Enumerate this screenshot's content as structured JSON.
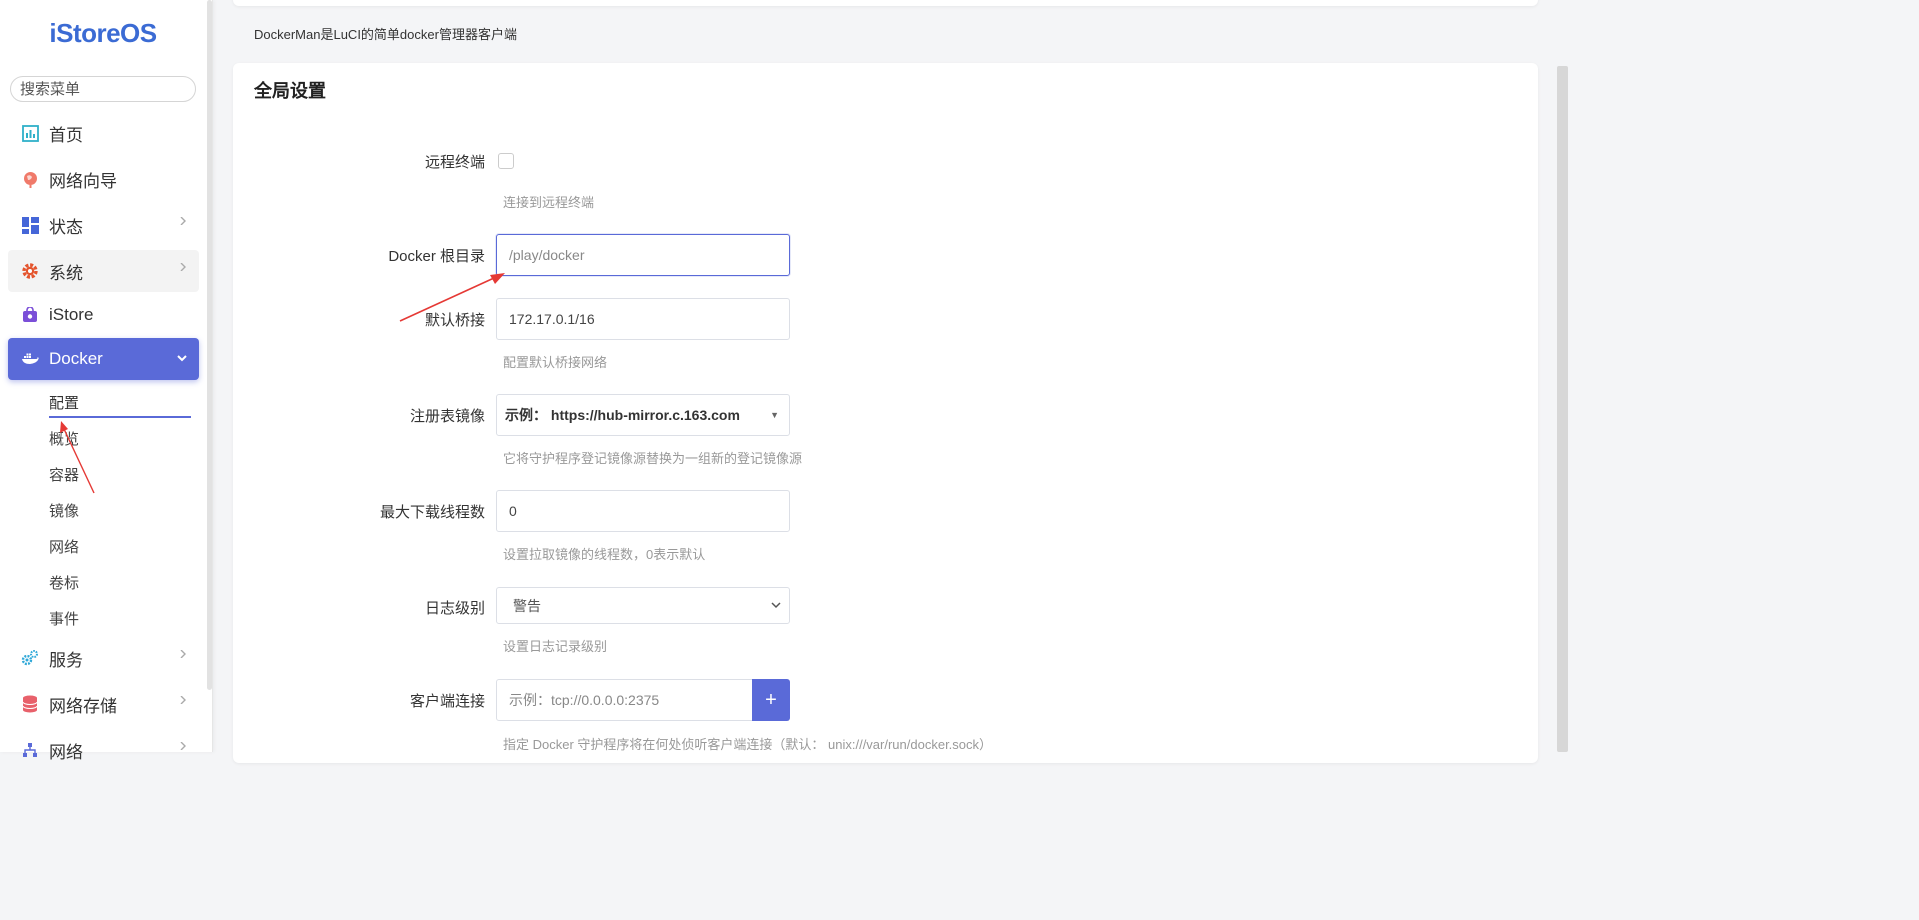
{
  "sidebar": {
    "logo": "iStoreOS",
    "search_placeholder": "搜索菜单",
    "items": [
      {
        "label": "首页",
        "icon": "chart-icon"
      },
      {
        "label": "网络向导",
        "icon": "globe-icon"
      },
      {
        "label": "状态",
        "icon": "dashboard-icon"
      },
      {
        "label": "系统",
        "icon": "gear-icon"
      },
      {
        "label": "iStore",
        "icon": "store-bag-icon"
      },
      {
        "label": "Docker",
        "icon": "docker-icon"
      },
      {
        "label": "服务",
        "icon": "gears-icon"
      },
      {
        "label": "网络存储",
        "icon": "database-icon"
      },
      {
        "label": "网络",
        "icon": "network-icon"
      }
    ],
    "docker_submenu": [
      "配置",
      "概览",
      "容器",
      "镜像",
      "网络",
      "卷标",
      "事件"
    ]
  },
  "main": {
    "description": "DockerMan是LuCI的简单docker管理器客户端",
    "section_title": "全局设置",
    "fields": {
      "remote_endpoint": {
        "label": "远程终端",
        "hint": "连接到远程终端",
        "checked": false
      },
      "docker_root": {
        "label": "Docker 根目录",
        "placeholder": "/play/docker"
      },
      "default_bridge": {
        "label": "默认桥接",
        "value": "172.17.0.1/16",
        "hint": "配置默认桥接网络"
      },
      "registry_mirror": {
        "label": "注册表镜像",
        "value": "示例：  https://hub-mirror.c.163.com",
        "hint": "它将守护程序登记镜像源替换为一组新的登记镜像源"
      },
      "max_downloads": {
        "label": "最大下载线程数",
        "value": "0",
        "hint": "设置拉取镜像的线程数，0表示默认"
      },
      "log_level": {
        "label": "日志级别",
        "value": "警告",
        "hint": "设置日志记录级别"
      },
      "client_connect": {
        "label": "客户端连接",
        "placeholder": "示例：tcp://0.0.0.0:2375",
        "add_label": "+",
        "hint": "指定 Docker 守护程序将在何处侦听客户端连接（默认： unix:///var/run/docker.sock）"
      }
    }
  },
  "colors": {
    "accent": "#5a6ad8",
    "logo": "#3b6bd4",
    "annotation_arrow": "#e53935"
  }
}
